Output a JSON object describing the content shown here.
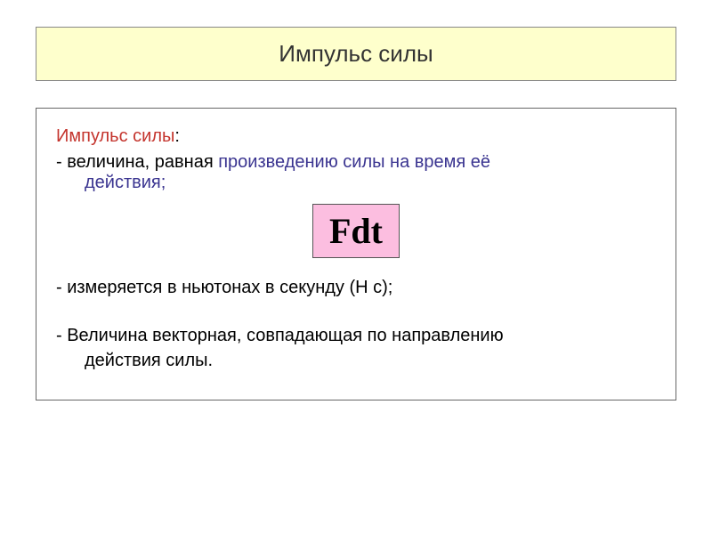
{
  "title": "Импульс силы",
  "term": "Импульс силы",
  "colon": ":",
  "def_prefix": "- величина, равная ",
  "def_highlight_line1": "произведению силы на время её",
  "def_highlight_line2": "действия;",
  "formula": "Fdt",
  "bullet2": "- измеряется в ньютонах в секунду (Н с);",
  "bullet3_line1": "-  Величина векторная, совпадающая по направлению",
  "bullet3_line2": "действия силы."
}
